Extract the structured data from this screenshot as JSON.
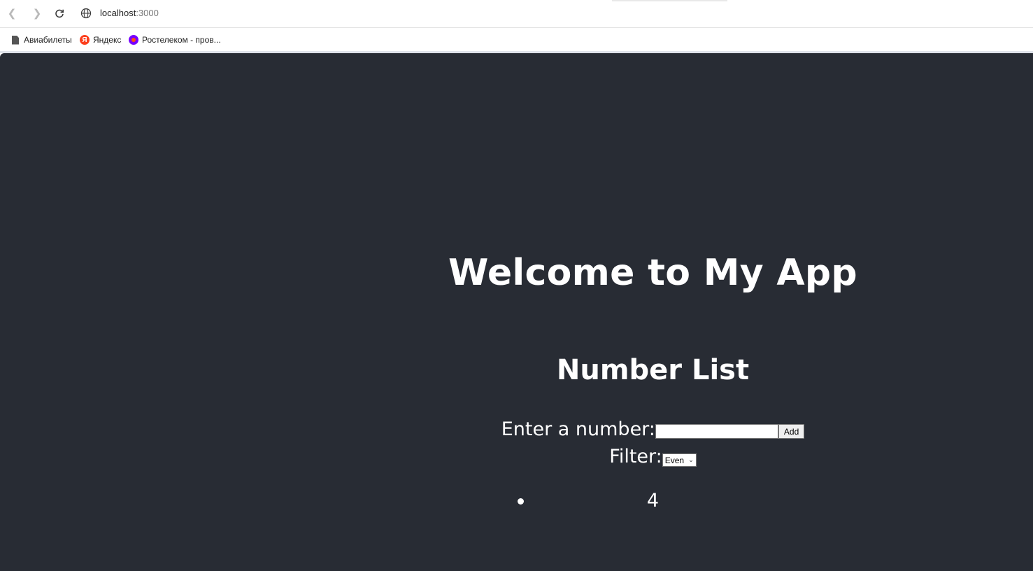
{
  "browser": {
    "url_host": "localhost",
    "url_port": ":3000",
    "bookmarks": [
      {
        "label": "Авиабилеты",
        "icon": "document-icon"
      },
      {
        "label": "Яндекс",
        "icon": "yandex-icon",
        "badge": "Я"
      },
      {
        "label": "Ростелеком - пров...",
        "icon": "rostelecom-icon"
      }
    ]
  },
  "app": {
    "background": "#282c34",
    "title": "Welcome to My App",
    "subtitle": "Number List",
    "number_label": "Enter a number:",
    "number_value": "",
    "add_label": "Add",
    "filter_label": "Filter:",
    "filter_selected": "Even",
    "items": [
      "4"
    ]
  }
}
